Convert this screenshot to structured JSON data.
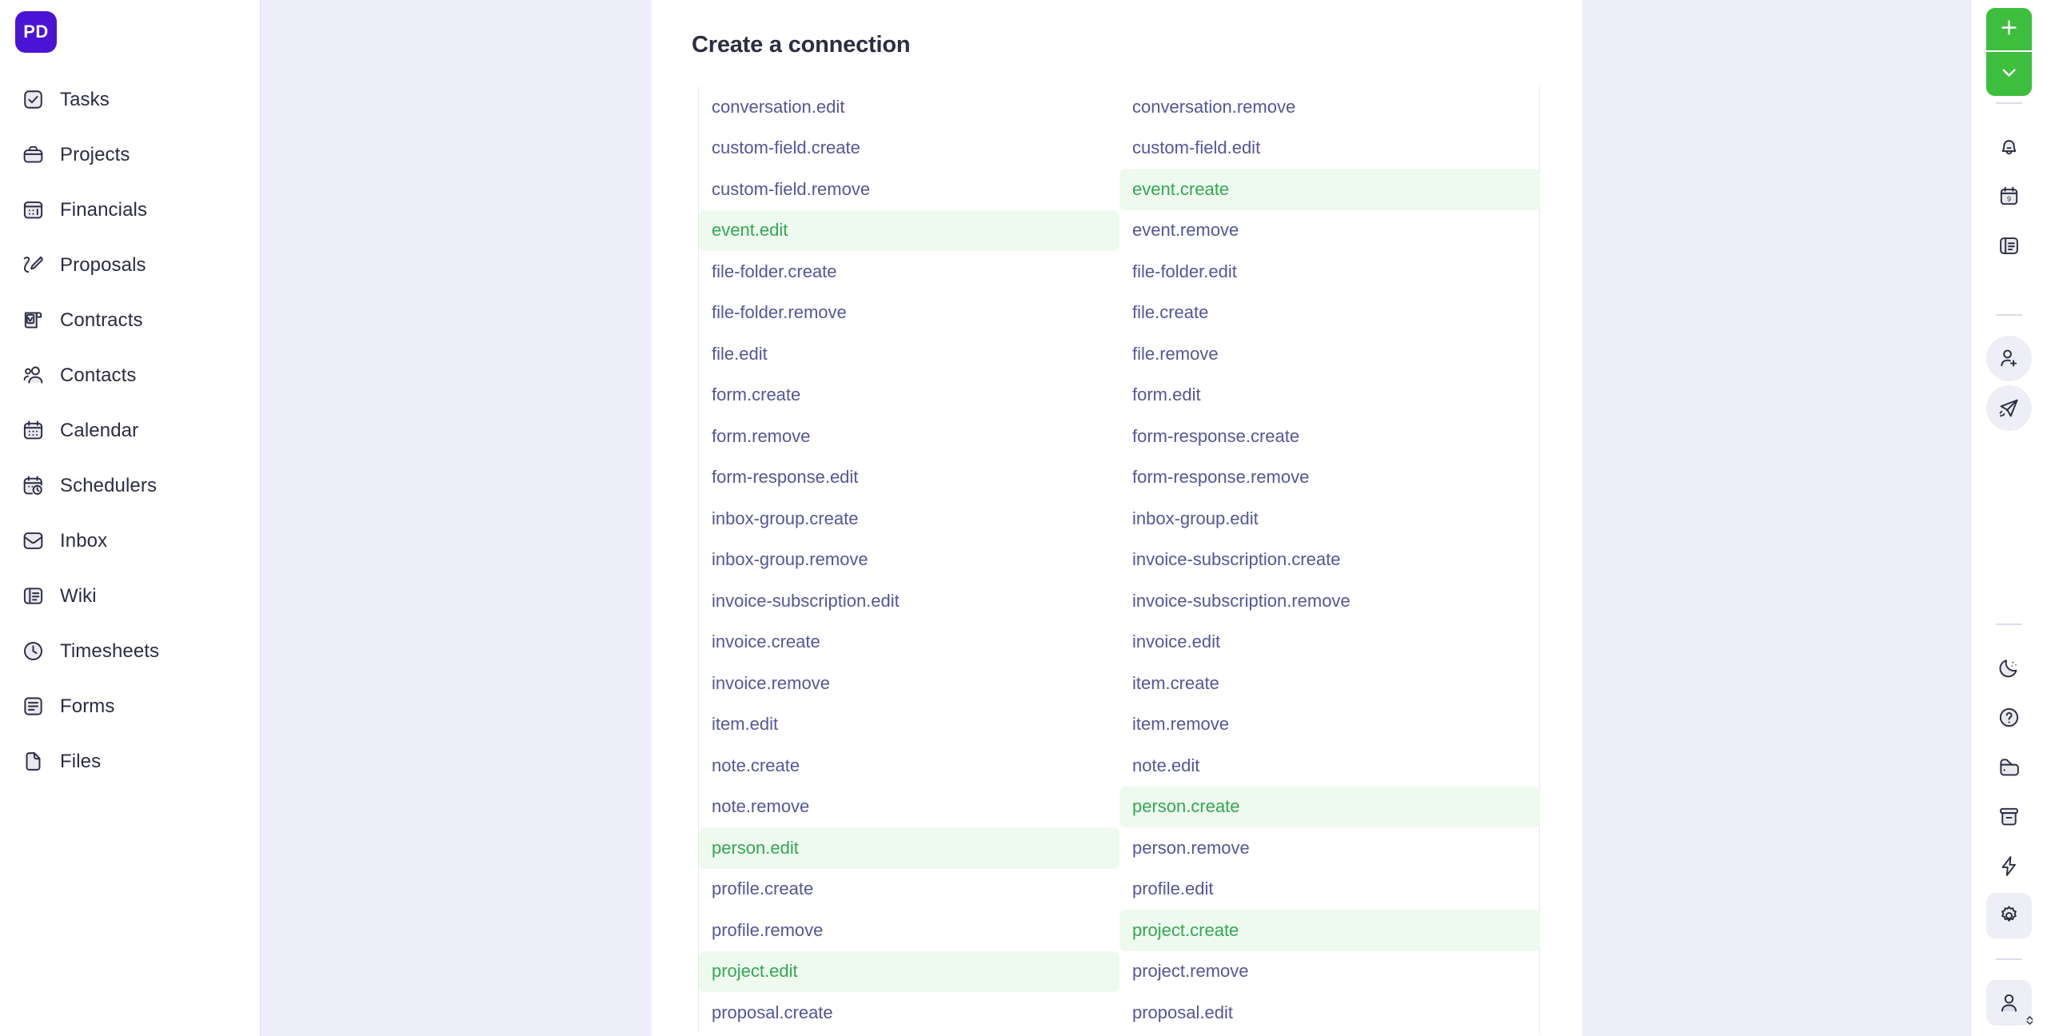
{
  "app": {
    "logo_initials": "PD"
  },
  "sidebar": {
    "items": [
      {
        "label": "Tasks",
        "icon": "check-square-icon"
      },
      {
        "label": "Projects",
        "icon": "briefcase-icon"
      },
      {
        "label": "Financials",
        "icon": "financial-calendar-icon"
      },
      {
        "label": "Proposals",
        "icon": "pencil-proposal-icon"
      },
      {
        "label": "Contracts",
        "icon": "contract-scroll-icon"
      },
      {
        "label": "Contacts",
        "icon": "people-icon"
      },
      {
        "label": "Calendar",
        "icon": "calendar-icon"
      },
      {
        "label": "Schedulers",
        "icon": "calendar-clock-icon"
      },
      {
        "label": "Inbox",
        "icon": "inbox-envelope-icon"
      },
      {
        "label": "Wiki",
        "icon": "wiki-book-icon"
      },
      {
        "label": "Timesheets",
        "icon": "clock-icon"
      },
      {
        "label": "Forms",
        "icon": "form-list-icon"
      },
      {
        "label": "Files",
        "icon": "file-icon"
      }
    ]
  },
  "main": {
    "title": "Create a connection",
    "permissions": {
      "left_column": [
        {
          "label": "conversation.edit",
          "selected": false
        },
        {
          "label": "custom-field.create",
          "selected": false
        },
        {
          "label": "custom-field.remove",
          "selected": false
        },
        {
          "label": "event.edit",
          "selected": true
        },
        {
          "label": "file-folder.create",
          "selected": false
        },
        {
          "label": "file-folder.remove",
          "selected": false
        },
        {
          "label": "file.edit",
          "selected": false
        },
        {
          "label": "form.create",
          "selected": false
        },
        {
          "label": "form.remove",
          "selected": false
        },
        {
          "label": "form-response.edit",
          "selected": false
        },
        {
          "label": "inbox-group.create",
          "selected": false
        },
        {
          "label": "inbox-group.remove",
          "selected": false
        },
        {
          "label": "invoice-subscription.edit",
          "selected": false
        },
        {
          "label": "invoice.create",
          "selected": false
        },
        {
          "label": "invoice.remove",
          "selected": false
        },
        {
          "label": "item.edit",
          "selected": false
        },
        {
          "label": "note.create",
          "selected": false
        },
        {
          "label": "note.remove",
          "selected": false
        },
        {
          "label": "person.edit",
          "selected": true
        },
        {
          "label": "profile.create",
          "selected": false
        },
        {
          "label": "profile.remove",
          "selected": false
        },
        {
          "label": "project.edit",
          "selected": true
        },
        {
          "label": "proposal.create",
          "selected": false
        }
      ],
      "right_column": [
        {
          "label": "conversation.remove",
          "selected": false
        },
        {
          "label": "custom-field.edit",
          "selected": false
        },
        {
          "label": "event.create",
          "selected": true
        },
        {
          "label": "event.remove",
          "selected": false
        },
        {
          "label": "file-folder.edit",
          "selected": false
        },
        {
          "label": "file.create",
          "selected": false
        },
        {
          "label": "file.remove",
          "selected": false
        },
        {
          "label": "form.edit",
          "selected": false
        },
        {
          "label": "form-response.create",
          "selected": false
        },
        {
          "label": "form-response.remove",
          "selected": false
        },
        {
          "label": "inbox-group.edit",
          "selected": false
        },
        {
          "label": "invoice-subscription.create",
          "selected": false
        },
        {
          "label": "invoice-subscription.remove",
          "selected": false
        },
        {
          "label": "invoice.edit",
          "selected": false
        },
        {
          "label": "item.create",
          "selected": false
        },
        {
          "label": "item.remove",
          "selected": false
        },
        {
          "label": "note.edit",
          "selected": false
        },
        {
          "label": "person.create",
          "selected": true
        },
        {
          "label": "person.remove",
          "selected": false
        },
        {
          "label": "profile.edit",
          "selected": false
        },
        {
          "label": "project.create",
          "selected": true
        },
        {
          "label": "project.remove",
          "selected": false
        },
        {
          "label": "proposal.edit",
          "selected": false
        }
      ]
    }
  },
  "right_rail": {
    "add_button": {
      "icon": "plus-icon",
      "caret_icon": "chevron-down-icon"
    },
    "top_icons": [
      {
        "icon": "bell-icon"
      },
      {
        "icon": "calendar-day-icon",
        "badge": "9"
      },
      {
        "icon": "notes-panel-icon"
      }
    ],
    "mid_icons": [
      {
        "icon": "add-person-icon"
      },
      {
        "icon": "paper-plane-icon"
      }
    ],
    "bottom_icons": [
      {
        "icon": "moon-icon"
      },
      {
        "icon": "help-circle-icon"
      },
      {
        "icon": "wallet-icon"
      },
      {
        "icon": "archive-box-icon"
      },
      {
        "icon": "lightning-bolt-icon"
      },
      {
        "icon": "gear-icon"
      }
    ],
    "account": {
      "icon": "user-avatar-icon",
      "chevron": "chevron-up-down-icon"
    }
  },
  "colors": {
    "brand_purple": "#4b14d4",
    "accent_green": "#3dbf3d",
    "selected_text": "#32a852",
    "selected_bg": "#effaef",
    "panel_bg": "#eeeefb",
    "text_primary": "#2b2d42",
    "text_list": "#55569a"
  }
}
